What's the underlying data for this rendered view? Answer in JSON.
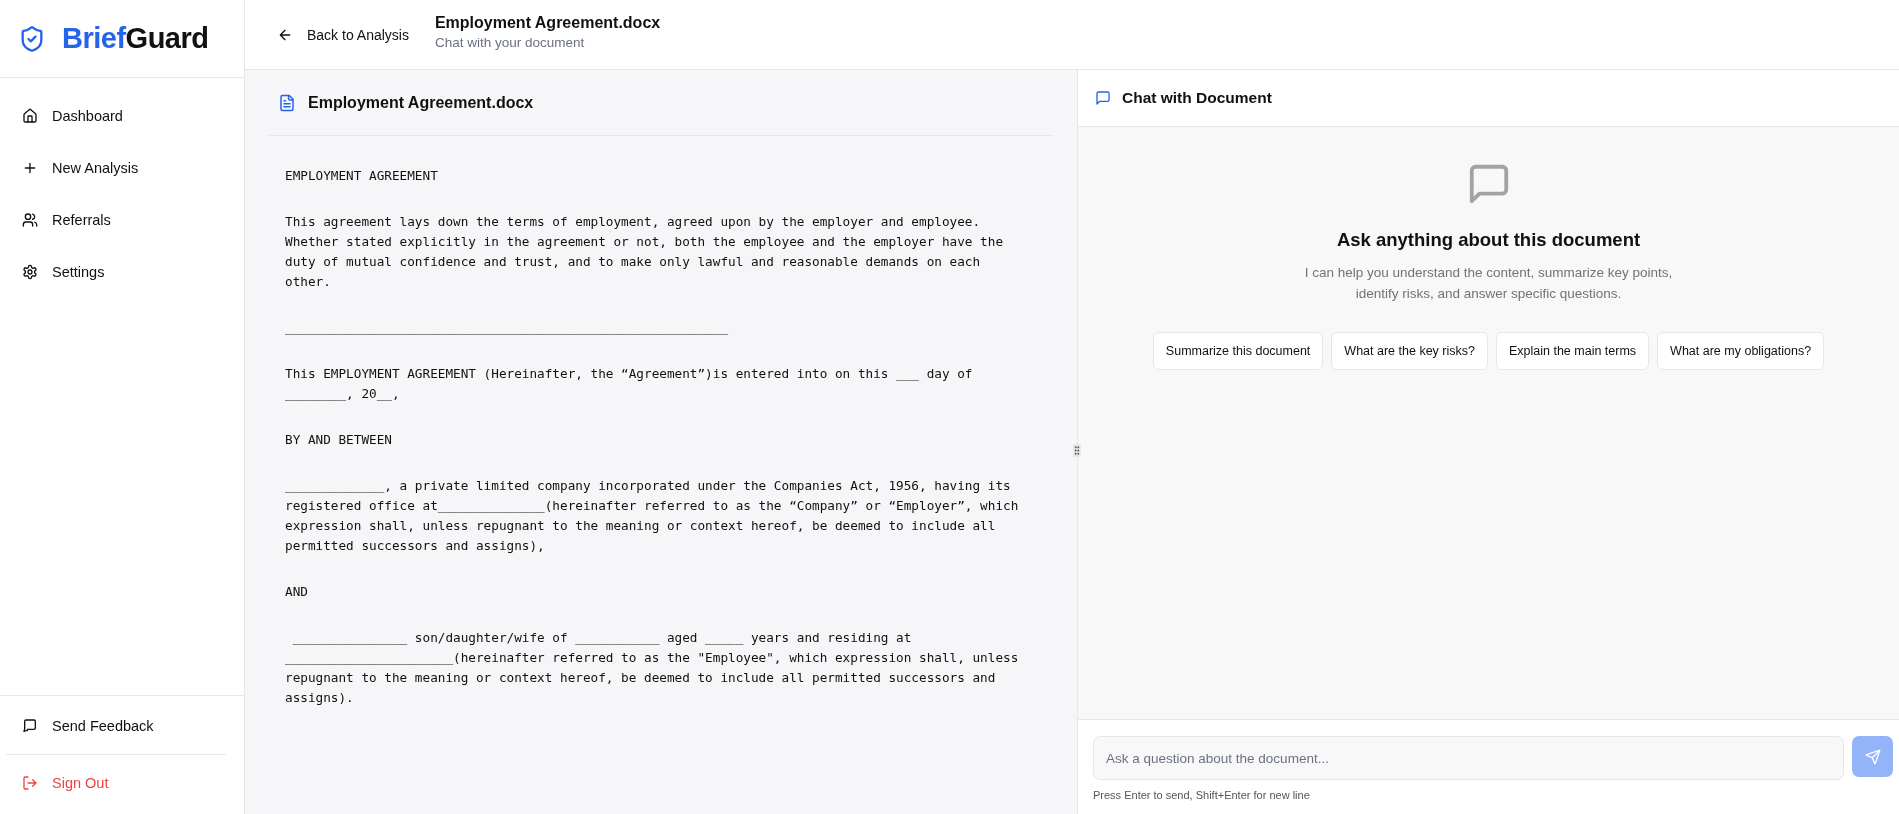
{
  "sidebar": {
    "logo": {
      "part_1": "Brief",
      "part_2": "Guard"
    },
    "nav": [
      {
        "label": "Dashboard",
        "kind": "home"
      },
      {
        "label": "New Analysis",
        "kind": "create"
      },
      {
        "label": "Referrals",
        "kind": "referrals"
      },
      {
        "label": "Settings",
        "kind": "settings"
      }
    ],
    "footer": [
      {
        "label": "Send Feedback",
        "kind": "feedback"
      },
      {
        "label": "Sign Out",
        "kind": "signout"
      }
    ]
  },
  "header": {
    "back": "Back to Analysis",
    "title": "Employment Agreement.docx",
    "subtitle": "Chat with your document"
  },
  "document": {
    "title": "Employment Agreement.docx",
    "paragraphs": [
      "EMPLOYMENT AGREEMENT",
      "This agreement lays down the terms of employment, agreed upon by the employer and employee.\nWhether stated explicitly in the agreement or not, both the employee and the employer have the\nduty of mutual confidence and trust, and to make only lawful and reasonable demands on each\nother.",
      "__________________________________________________________",
      "This EMPLOYMENT AGREEMENT (Hereinafter, the “Agreement”)is entered into on this ___ day of\n________, 20__,",
      "BY AND BETWEEN",
      "_____________, a private limited company incorporated under the Companies Act, 1956, having its\nregistered office at______________(hereinafter referred to as the “Company” or “Employer”, which\nexpression shall, unless repugnant to the meaning or context hereof, be deemed to include all\npermitted successors and assigns),",
      "AND",
      " _______________ son/daughter/wife of ___________ aged _____ years and residing at\n______________________(hereinafter referred to as the \"Employee\", which expression shall, unless\nrepugnant to the meaning or context hereof, be deemed to include all permitted successors and\nassigns)."
    ]
  },
  "chat": {
    "title": "Chat with Document",
    "empty_title": "Ask anything about this document",
    "empty_text": "I can help you understand the content, summarize key points,\nidentify risks, and answer specific questions.",
    "suggestions": [
      "Summarize this document",
      "What are the key risks?",
      "Explain the main terms",
      "What are my obligations?"
    ],
    "input": {
      "placeholder": "Ask a question about the document..."
    },
    "hint": "Press Enter to send, Shift+Enter for new line"
  }
}
